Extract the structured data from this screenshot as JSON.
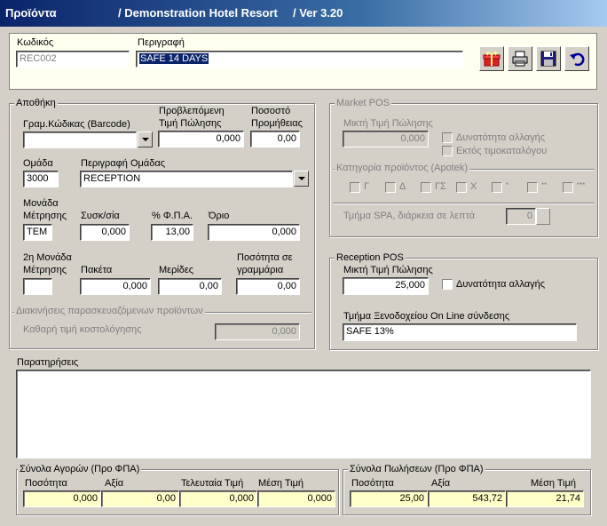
{
  "window": {
    "title": "Προϊόντα",
    "hotel": "/ Demonstration Hotel Resort",
    "version": "/  Ver  3.20"
  },
  "header": {
    "code_label": "Κωδικός",
    "code_value": "REC002",
    "desc_label": "Περιγραφή",
    "desc_value": "SAFE 14 DAYS"
  },
  "toolbar": {
    "icons": [
      "gift-icon",
      "print-icon",
      "save-icon",
      "undo-icon"
    ]
  },
  "warehouse": {
    "title": "Αποθήκη",
    "barcode_label": "Γραμ.Κώδικας (Barcode)",
    "barcode_value": "",
    "price_label_1": "Προβλεπόμενη",
    "price_label_2": "Τιμή Πώλησης",
    "price_value": "0,000",
    "commission_label_1": "Ποσοστό",
    "commission_label_2": "Προμήθειας",
    "commission_value": "0,00",
    "group_label": "Ομάδα",
    "group_value": "3000",
    "group_desc_label": "Περιγραφή Ομάδας",
    "group_desc_value": "RECEPTION",
    "unit_label_1": "Μονάδα",
    "unit_label_2": "Μέτρησης",
    "unit_value": "TEM",
    "pack_label": "Συσκ/σία",
    "pack_value": "0,000",
    "vat_label": "% Φ.Π.Α.",
    "vat_value": "13,00",
    "limit_label": "Όριο",
    "limit_value": "0,000",
    "unit2_label_1": "2η Μονάδα",
    "unit2_label_2": "Μέτρησης",
    "unit2_value": "",
    "packets_label": "Πακέτα",
    "packets_value": "0,000",
    "portions_label": "Μερίδες",
    "portions_value": "0,00",
    "grams_label_1": "Ποσότητα σε",
    "grams_label_2": "γραμμάρια",
    "grams_value": "0,00",
    "prepared_title": "Διακινήσεις παρασκευαζόμενων προϊόντων",
    "net_cost_label": "Καθαρή τιμή κοστολόγησης",
    "net_cost_value": "0,000"
  },
  "market_pos": {
    "title": "Market POS",
    "price_label": "Μικτή Τιμή Πώλησης",
    "price_value": "0,000",
    "change_label": "Δυνατότητα αλλαγής",
    "catalog_label": "Εκτός τιμοκαταλόγου",
    "category_title": "Κατηγορία προϊόντος (Apotek)",
    "categories": [
      "Γ",
      "Δ",
      "ΓΣ",
      "Χ",
      "*",
      "**",
      "***"
    ],
    "spa_label": "Τμήμα SPA, διάρκεια σε λεπτά",
    "spa_value": "0"
  },
  "reception_pos": {
    "title": "Reception POS",
    "price_label": "Μικτή Τιμή Πώλησης",
    "price_value": "25,000",
    "change_label": "Δυνατότητα αλλαγής",
    "dept_label": "Τμήμα Ξενοδοχείου On Line σύνδεσης",
    "dept_value": "SAFE 13%"
  },
  "notes": {
    "label": "Παρατηρήσεις",
    "value": ""
  },
  "purchases": {
    "title": "Σύνολα Αγορών (Προ ΦΠΑ)",
    "headers": [
      "Ποσότητα",
      "Αξία",
      "Τελευταία Τιμή",
      "Μέση Τιμή"
    ],
    "values": [
      "0,000",
      "0,00",
      "0,000",
      "0,000"
    ]
  },
  "sales": {
    "title": "Σύνολα Πωλήσεων (Προ ΦΠΑ)",
    "headers": [
      "Ποσότητα",
      "Αξία",
      "Μέση Τιμή"
    ],
    "values": [
      "25,00",
      "543,72",
      "21,74"
    ]
  },
  "colors": {
    "title_start": "#0a246a",
    "header_panel": "#fffff0",
    "selection": "#0a246a",
    "totals_field": "#ffffc8"
  }
}
